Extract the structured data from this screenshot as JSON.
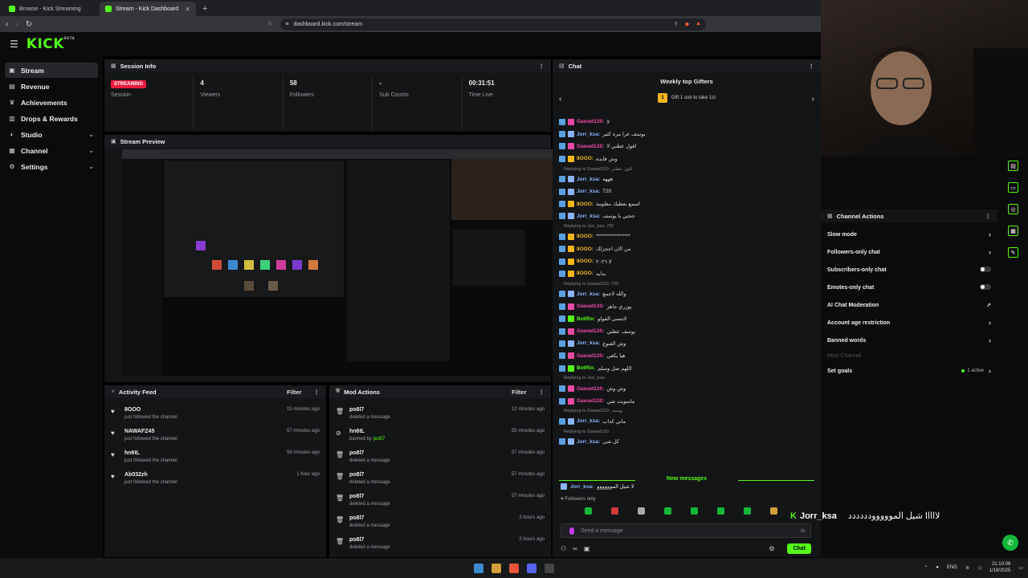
{
  "browser": {
    "tabs": [
      {
        "title": "Browse - Kick Streaming",
        "active": false
      },
      {
        "title": "Stream - Kick Dashboard",
        "active": true
      }
    ],
    "url": "dashboard.kick.com/stream"
  },
  "app": {
    "logo": "KICK",
    "logo_sup": "BETA"
  },
  "sidebar": {
    "items": [
      {
        "label": "Stream",
        "icon": "broadcast-icon",
        "active": true
      },
      {
        "label": "Revenue",
        "icon": "wallet-icon"
      },
      {
        "label": "Achievements",
        "icon": "trophy-icon"
      },
      {
        "label": "Drops & Rewards",
        "icon": "chart-icon"
      },
      {
        "label": "Studio",
        "icon": "studio-icon",
        "chevron": true
      },
      {
        "label": "Channel",
        "icon": "channel-icon",
        "chevron": true
      },
      {
        "label": "Settings",
        "icon": "gear-icon",
        "chevron": true
      }
    ]
  },
  "session": {
    "title": "Session Info",
    "cells": [
      {
        "value": "STREAMING",
        "label": "Session"
      },
      {
        "value": "4",
        "label": "Viewers"
      },
      {
        "value": "58",
        "label": "Followers"
      },
      {
        "value": "-",
        "label": "Sub Counts"
      },
      {
        "value": "00:31:51",
        "label": "Time Live"
      }
    ]
  },
  "preview": {
    "title": "Stream Preview"
  },
  "activity": {
    "title": "Activity Feed",
    "filter": "Filter",
    "items": [
      {
        "name": "8OOO",
        "sub": "just followed the channel",
        "time": "15 minutes ago"
      },
      {
        "name": "NAWAFZ45",
        "sub": "just followed the channel",
        "time": "57 minutes ago"
      },
      {
        "name": "hn6tL",
        "sub": "just followed the channel",
        "time": "58 minutes ago"
      },
      {
        "name": "Ab032zh",
        "sub": "just followed the channel",
        "time": "1 hour ago"
      }
    ]
  },
  "mod": {
    "title": "Mod Actions",
    "filter": "Filter",
    "items": [
      {
        "name": "po8l7",
        "sub": "deleted a message",
        "by": "",
        "time": "12 minutes ago",
        "icon": "trash-icon"
      },
      {
        "name": "hn6tL",
        "sub": "banned by",
        "by": "po8l7",
        "time": "55 minutes ago",
        "icon": "ban-icon"
      },
      {
        "name": "po8l7",
        "sub": "deleted a message",
        "by": "",
        "time": "57 minutes ago",
        "icon": "trash-icon"
      },
      {
        "name": "po8l7",
        "sub": "deleted a message",
        "by": "",
        "time": "57 minutes ago",
        "icon": "trash-icon"
      },
      {
        "name": "po8l7",
        "sub": "deleted a message",
        "by": "",
        "time": "57 minutes ago",
        "icon": "trash-icon"
      },
      {
        "name": "po8l7",
        "sub": "deleted a message",
        "by": "",
        "time": "2 hours ago",
        "icon": "trash-icon"
      },
      {
        "name": "po8l7",
        "sub": "deleted a message",
        "by": "",
        "time": "2 hours ago",
        "icon": "trash-icon"
      }
    ]
  },
  "chat": {
    "title": "Chat",
    "gifters_title": "Weekly top Gifters",
    "gift_cta": "Gift 1 sub to take 1st",
    "gift_rank": "1",
    "messages": [
      {
        "user": "Gawad120:",
        "text": "لا",
        "color": "#e84aa2"
      },
      {
        "user": "Jorr_ksa:",
        "text": "يوسف عرا مره كثير",
        "color": "#8ab4f8"
      },
      {
        "user": "Gawad120:",
        "text": "اقول عطني لا",
        "color": "#e84aa2"
      },
      {
        "user": "8OOO:",
        "text": "وش فايده",
        "color": "#f5b51b"
      },
      {
        "reply": "Replying to Gawad120: اقول عطني"
      },
      {
        "user": "Jorr_ksa:",
        "text": "هههه",
        "color": "#8ab4f8"
      },
      {
        "user": "Jorr_ksa:",
        "text": "720",
        "color": "#8ab4f8"
      },
      {
        "user": "8OOO:",
        "text": "اسمع بعطيك معلومة",
        "color": "#f5b51b"
      },
      {
        "user": "Jorr_ksa:",
        "text": "جحتي يا يوسف",
        "color": "#8ab4f8"
      },
      {
        "reply": "Replying to Jorr_ksa: 720"
      },
      {
        "user": "8OOO:",
        "text": "*****************",
        "color": "#f5b51b"
      },
      {
        "user": "8OOO:",
        "text": "من الان احجزلك",
        "color": "#f5b51b"
      },
      {
        "user": "8OOO:",
        "text": "لا ٢٠٢٦",
        "color": "#f5b51b"
      },
      {
        "user": "8OOO:",
        "text": "بدايه",
        "color": "#f5b51b"
      },
      {
        "reply": "Replying to Gawad120: 730"
      },
      {
        "user": "Jorr_ksa:",
        "text": "والله لاجمع",
        "color": "#8ab4f8"
      },
      {
        "user": "Gawad120:",
        "text": "يوزري جاهز",
        "color": "#e84aa2"
      },
      {
        "user": "BotRix:",
        "text": "لاتنسى الفولو",
        "color": "#53fc18"
      },
      {
        "user": "Gawad120:",
        "text": "يوسف عطني",
        "color": "#e84aa2"
      },
      {
        "user": "Jorr_ksa:",
        "text": "وش القنوع",
        "color": "#8ab4f8"
      },
      {
        "user": "Gawad120:",
        "text": "هيا يكفي",
        "color": "#e84aa2"
      },
      {
        "user": "BotRix:",
        "text": "اللهم صل وسلم",
        "color": "#53fc18"
      },
      {
        "reply": "Replying to Jorr_ksa:"
      },
      {
        "user": "Gawad120:",
        "text": "وش وش",
        "color": "#e84aa2"
      },
      {
        "user": "Gawad120:",
        "text": "ماسويت شي",
        "color": "#e84aa2"
      },
      {
        "reply": "Replying to Gawad120: يوسف"
      },
      {
        "user": "Jorr_ksa:",
        "text": "ماني كذاب",
        "color": "#8ab4f8"
      },
      {
        "reply": "Replying to Gawad120:"
      },
      {
        "user": "Jorr_ksa:",
        "text": "كل شي",
        "color": "#8ab4f8"
      }
    ],
    "new_messages": "New messages",
    "last_message": {
      "user": "Jorr_ksa:",
      "text": "لا شيل الموووووو"
    },
    "followers_only": "Followers only",
    "placeholder": "Send a message",
    "send_label": "Chat"
  },
  "channel_actions": {
    "title": "Channel Actions",
    "rows": [
      {
        "label": "Slow mode",
        "control": "chevron"
      },
      {
        "label": "Followers-only chat",
        "control": "chevron"
      },
      {
        "label": "Subscribers-only chat",
        "control": "toggle"
      },
      {
        "label": "Emotes-only chat",
        "control": "toggle"
      },
      {
        "label": "AI Chat Moderation",
        "control": "link"
      },
      {
        "label": "Account age restriction",
        "control": "chevron"
      },
      {
        "label": "Banned words",
        "control": "chevron"
      },
      {
        "label": "Host Channel",
        "control": "none",
        "dim": true
      },
      {
        "label": "Set goals",
        "control": "chevron",
        "extra": "1 active"
      }
    ]
  },
  "overlay": {
    "k": "K",
    "name": "Jorr_ksa",
    "text": "لااااا شيل المووووودددددد"
  },
  "taskbar": {
    "lang": "ENG",
    "time": "21:10:06",
    "date": "1/19/2025"
  }
}
